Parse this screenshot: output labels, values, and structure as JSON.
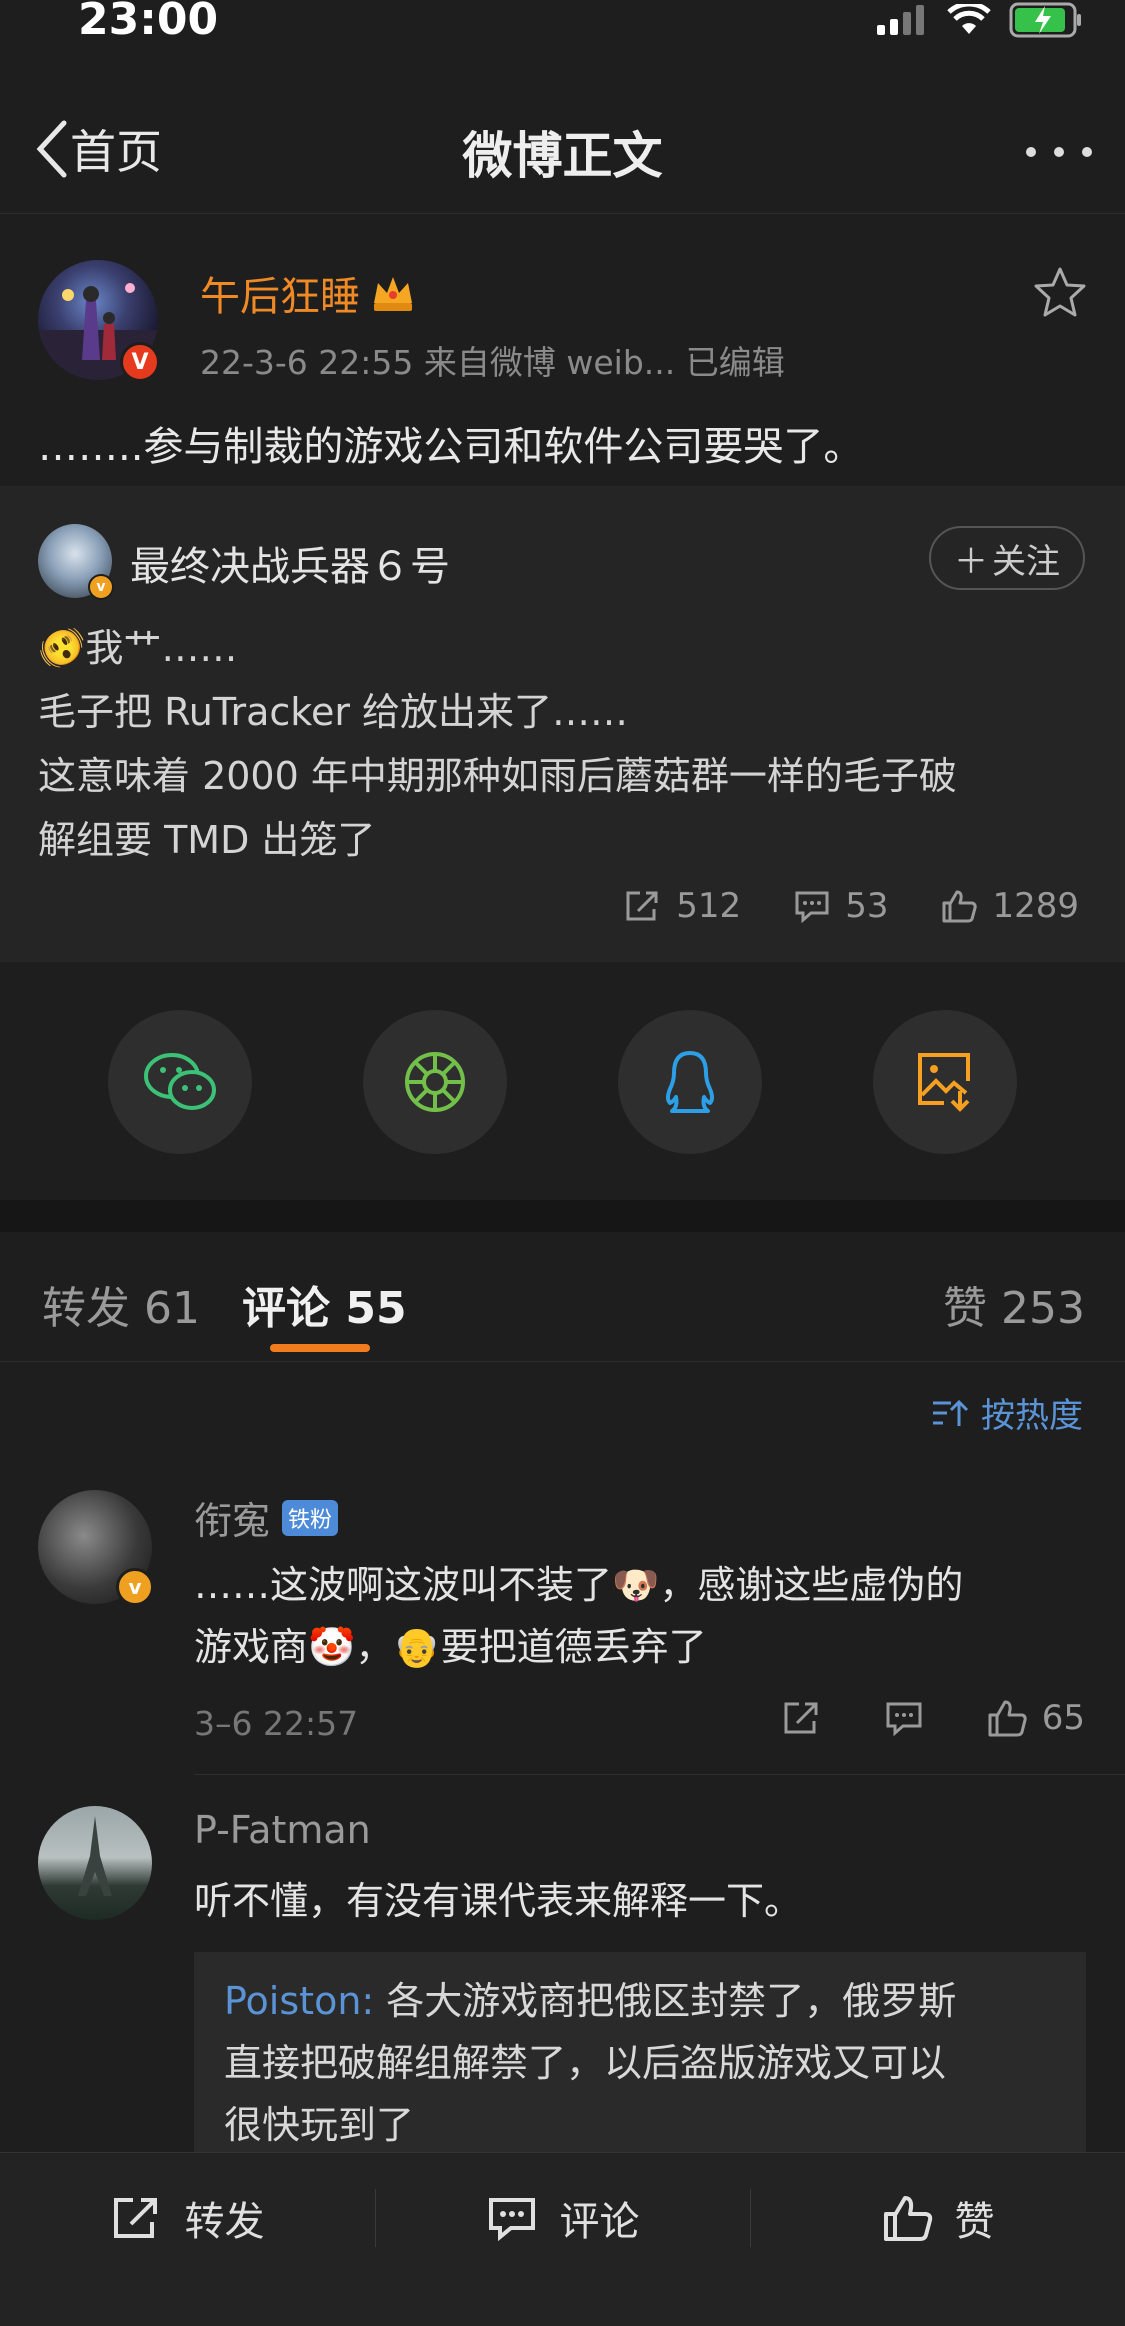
{
  "status_bar": {
    "time": "23:00"
  },
  "nav": {
    "back_label": "首页",
    "title": "微博正文"
  },
  "post": {
    "author": "午后狂睡",
    "meta": "22-3-6 22:55  来自微博 weib...  已编辑",
    "text": "……..参与制裁的游戏公司和软件公司要哭了。"
  },
  "repost": {
    "author": "最终决战兵器６号",
    "follow_label": "关注",
    "lines": [
      "🫨我艹……",
      "毛子把 RuTracker 给放出来了……",
      "这意味着 2000 年中期那种如雨后蘑菇群一样的毛子破",
      "解组要 TMD 出笼了"
    ],
    "reposts": "512",
    "comments": "53",
    "likes": "1289"
  },
  "share": {
    "wechat": "wechat-icon",
    "moments": "moments-icon",
    "qq": "qq-icon",
    "save": "save-image-icon"
  },
  "tabs": {
    "repost_label": "转发",
    "repost_count": "61",
    "comment_label": "评论",
    "comment_count": "55",
    "like_label": "赞",
    "like_count": "253"
  },
  "sort_label": "按热度",
  "comments": [
    {
      "name": "衔寃",
      "badge": "铁粉",
      "line1": "……这波啊这波叫不装了🐶，感谢这些虚伪的",
      "line2": "游戏商🤡，👴要把道德丢弃了",
      "time": "3–6 22:57",
      "likes": "65"
    },
    {
      "name": "P-Fatman",
      "line1": "听不懂，有没有课代表来解释一下。",
      "reply_user": "Poiston:",
      "reply_lines": [
        "各大游戏商把俄区封禁了，俄罗斯",
        "直接把破解组解禁了，以后盗版游戏又可以",
        "很快玩到了"
      ]
    }
  ],
  "bottom_bar": {
    "repost": "转发",
    "comment": "评论",
    "like": "赞"
  },
  "colors": {
    "accent": "#f07c1e",
    "link": "#5a94d6",
    "bg": "#1e1e1e"
  }
}
